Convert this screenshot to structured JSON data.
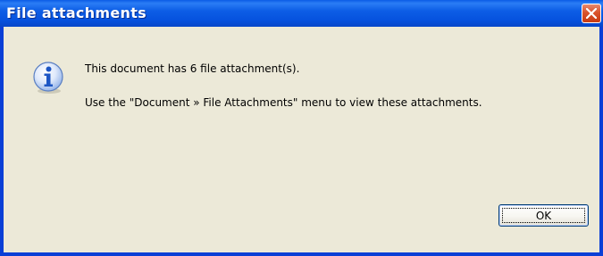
{
  "window": {
    "title": "File attachments"
  },
  "message": {
    "line1": "This document has 6 file attachment(s).",
    "line2": "Use the \"Document » File Attachments\" menu to view these attachments."
  },
  "buttons": {
    "ok_label": "OK"
  },
  "icons": {
    "info": "info-icon",
    "close": "close-icon"
  },
  "colors": {
    "titlebar": "#0a5be6",
    "client_bg": "#ece9d8",
    "close_button": "#d9532c",
    "info_icon": "#2c6fd6"
  }
}
